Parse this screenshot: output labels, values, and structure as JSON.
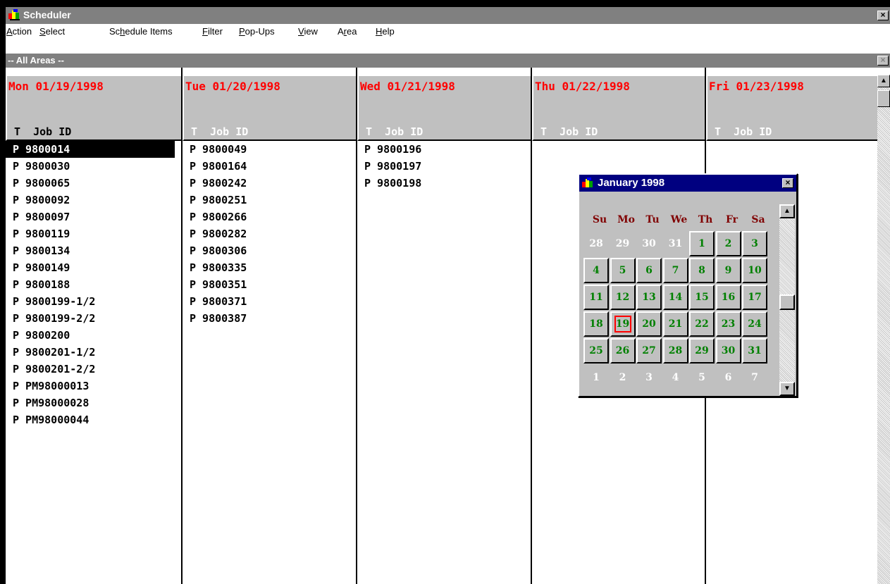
{
  "window": {
    "title": "Scheduler",
    "close_glyph": "×"
  },
  "menu": [
    {
      "before": "",
      "accel": "A",
      "after": "ction"
    },
    {
      "before": "",
      "accel": "S",
      "after": "elect"
    },
    {
      "before": "Sc",
      "accel": "h",
      "after": "edule Items"
    },
    {
      "before": "",
      "accel": "F",
      "after": "ilter"
    },
    {
      "before": "",
      "accel": "P",
      "after": "op-Ups"
    },
    {
      "before": "",
      "accel": "V",
      "after": "iew"
    },
    {
      "before": "A",
      "accel": "r",
      "after": "ea"
    },
    {
      "before": "",
      "accel": "H",
      "after": "elp"
    }
  ],
  "area": {
    "label": "-- All Areas --",
    "close_glyph": "×"
  },
  "days": [
    {
      "date": "Mon 01/19/1998",
      "header": "T  Job ID",
      "selected": true,
      "jobs": [
        "P 9800014",
        "P 9800030",
        "P 9800065",
        "P 9800092",
        "P 9800097",
        "P 9800119",
        "P 9800134",
        "P 9800149",
        "P 9800188",
        "P 9800199-1/2",
        "P 9800199-2/2",
        "P 9800200",
        "P 9800201-1/2",
        "P 9800201-2/2",
        "P PM98000013",
        "P PM98000028",
        "P PM98000044"
      ]
    },
    {
      "date": "Tue 01/20/1998",
      "header": "T  Job ID",
      "selected": false,
      "jobs": [
        "P 9800049",
        "P 9800164",
        "P 9800242",
        "P 9800251",
        "P 9800266",
        "P 9800282",
        "P 9800306",
        "P 9800335",
        "P 9800351",
        "P 9800371",
        "P 9800387"
      ]
    },
    {
      "date": "Wed 01/21/1998",
      "header": "T  Job ID",
      "selected": false,
      "jobs": [
        "P 9800196",
        "P 9800197",
        "P 9800198"
      ]
    },
    {
      "date": "Thu 01/22/1998",
      "header": "T  Job ID",
      "selected": false,
      "jobs": []
    },
    {
      "date": "Fri 01/23/1998",
      "header": "T  Job ID",
      "selected": false,
      "jobs": []
    }
  ],
  "calendar": {
    "title": "January 1998",
    "close_glyph": "×",
    "weekdays": [
      "Su",
      "Mo",
      "Tu",
      "We",
      "Th",
      "Fr",
      "Sa"
    ],
    "weeks": [
      [
        {
          "d": "28",
          "m": "prev"
        },
        {
          "d": "29",
          "m": "prev"
        },
        {
          "d": "30",
          "m": "prev"
        },
        {
          "d": "31",
          "m": "prev"
        },
        {
          "d": "1"
        },
        {
          "d": "2"
        },
        {
          "d": "3"
        }
      ],
      [
        {
          "d": "4"
        },
        {
          "d": "5"
        },
        {
          "d": "6"
        },
        {
          "d": "7"
        },
        {
          "d": "8"
        },
        {
          "d": "9"
        },
        {
          "d": "10"
        }
      ],
      [
        {
          "d": "11"
        },
        {
          "d": "12"
        },
        {
          "d": "13"
        },
        {
          "d": "14"
        },
        {
          "d": "15"
        },
        {
          "d": "16"
        },
        {
          "d": "17"
        }
      ],
      [
        {
          "d": "18"
        },
        {
          "d": "19",
          "today": true
        },
        {
          "d": "20"
        },
        {
          "d": "21"
        },
        {
          "d": "22"
        },
        {
          "d": "23"
        },
        {
          "d": "24"
        }
      ],
      [
        {
          "d": "25"
        },
        {
          "d": "26"
        },
        {
          "d": "27"
        },
        {
          "d": "28"
        },
        {
          "d": "29"
        },
        {
          "d": "30"
        },
        {
          "d": "31"
        }
      ],
      [
        {
          "d": "1",
          "m": "next"
        },
        {
          "d": "2",
          "m": "next"
        },
        {
          "d": "3",
          "m": "next"
        },
        {
          "d": "4",
          "m": "next"
        },
        {
          "d": "5",
          "m": "next"
        },
        {
          "d": "6",
          "m": "next"
        },
        {
          "d": "7",
          "m": "next"
        }
      ]
    ]
  },
  "colors": {
    "date_red": "#ff0000",
    "calendar_day_green": "#008000",
    "weekday_maroon": "#800000",
    "popup_title_navy": "#000080"
  },
  "icons": {
    "app": "scheduler-app-icon",
    "scroll_up": "▲",
    "scroll_down": "▼"
  }
}
